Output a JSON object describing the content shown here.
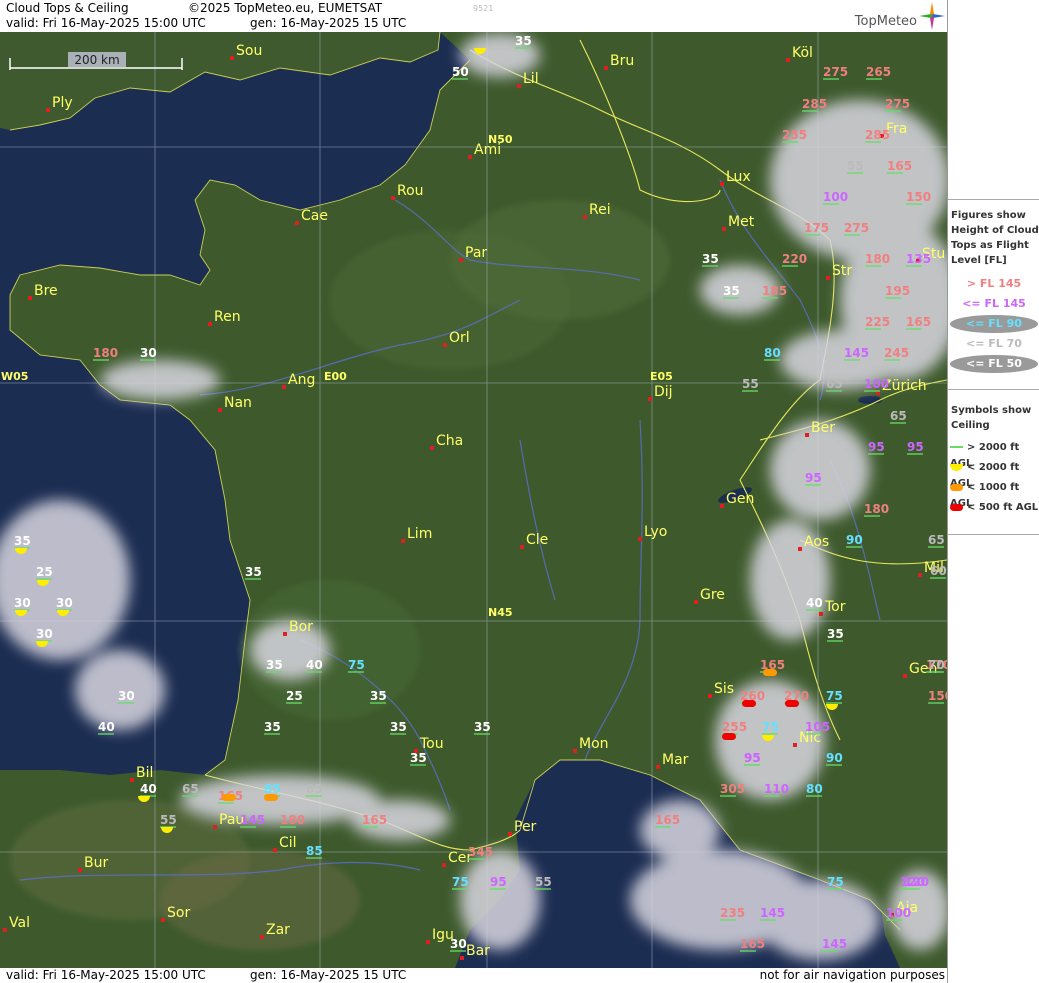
{
  "header": {
    "title": "Cloud Tops & Ceiling",
    "copyright": "©2025 TopMeteo.eu, EUMETSAT",
    "valid": "valid:  Fri  16-May-2025  15:00 UTC",
    "gen": "gen: 16-May-2025 15 UTC",
    "code": "9521",
    "brand": "TopMeteo"
  },
  "footer": {
    "valid": "valid:  Fri  16-May-2025  15:00 UTC",
    "gen": "gen: 16-May-2025 15 UTC",
    "note": "not for air navigation purposes"
  },
  "scale_label": "200 km",
  "grid_labels": [
    "N50",
    "N45",
    "E00",
    "E05",
    "W05"
  ],
  "legend": {
    "title_lines": [
      "Figures show",
      "Height of Cloud",
      "Tops as Flight",
      "Level  [FL]"
    ],
    "items": [
      {
        "label": "> FL 145",
        "color": "#f08080"
      },
      {
        "label": "<= FL 145",
        "color": "#cc66ff"
      },
      {
        "label": "<= FL 90",
        "color": "#66e0ff"
      },
      {
        "label": "<= FL 70",
        "color": "#bbbbbb"
      },
      {
        "label": "<= FL 50",
        "color": "#ffffff"
      }
    ],
    "symbols_title_lines": [
      "Symbols show",
      "Ceiling"
    ],
    "symbols": [
      {
        "label": "> 2000 ft AGL",
        "color": "#66dd66",
        "shape": "line"
      },
      {
        "label": "< 2000 ft AGL",
        "color": "#ffee00",
        "shape": "half-circle"
      },
      {
        "label": "< 1000 ft AGL",
        "color": "#ff9900",
        "shape": "bar"
      },
      {
        "label": "< 500 ft AGL",
        "color": "#ee0000",
        "shape": "bar"
      }
    ]
  },
  "cities": [
    "Sou",
    "Bru",
    "Köl",
    "Ply",
    "Lil",
    "Fra",
    "Ami",
    "Lux",
    "Rou",
    "Cae",
    "Rei",
    "Met",
    "Par",
    "Str",
    "Stu",
    "Bre",
    "Ren",
    "Orl",
    "Ang",
    "Dij",
    "Nan",
    "Zürich",
    "Ber",
    "Cha",
    "Gen",
    "Lim",
    "Cle",
    "Lyo",
    "Aos",
    "Mil",
    "Gre",
    "Tor",
    "Bor",
    "Gen",
    "Sis",
    "Tou",
    "Nic",
    "Mon",
    "Mar",
    "Bil",
    "Pau",
    "Per",
    "Cil",
    "Bur",
    "Cer",
    "Val",
    "Sor",
    "Zar",
    "Igu",
    "Bar",
    "Aja"
  ],
  "cloud_top_values": [
    "50",
    "35",
    "275",
    "265",
    "285",
    "275",
    "255",
    "285",
    "55",
    "165",
    "100",
    "150",
    "35",
    "220",
    "175",
    "275",
    "180",
    "135",
    "35",
    "185",
    "195",
    "225",
    "165",
    "80",
    "145",
    "245",
    "55",
    "65",
    "100",
    "65",
    "95",
    "95",
    "95",
    "180",
    "90",
    "65",
    "40",
    "35",
    "165",
    "260",
    "75",
    "270",
    "255",
    "75",
    "105",
    "95",
    "90",
    "305",
    "80",
    "165",
    "345",
    "75",
    "95",
    "55",
    "235",
    "145",
    "75",
    "120",
    "165",
    "145",
    "100",
    "180",
    "30",
    "35",
    "25",
    "30",
    "30",
    "30",
    "35",
    "30",
    "40",
    "35",
    "40",
    "75",
    "25",
    "35",
    "35",
    "35",
    "35",
    "35",
    "40",
    "65",
    "165",
    "85",
    "65",
    "55",
    "180",
    "165",
    "145",
    "85",
    "30",
    "120",
    "110",
    "95",
    "150",
    "170",
    "60",
    "70"
  ]
}
